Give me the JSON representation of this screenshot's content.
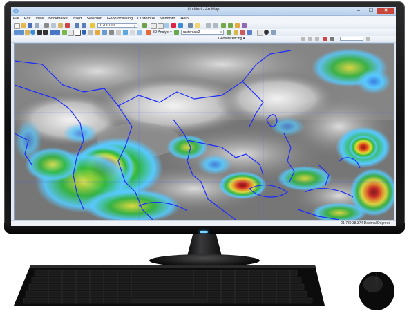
{
  "window": {
    "title": "Untitled - ArcMap",
    "minimize": "–",
    "maximize": "☐",
    "close": "✕"
  },
  "menu": [
    "File",
    "Edit",
    "View",
    "Bookmarks",
    "Insert",
    "Selection",
    "Geoprocessing",
    "Customize",
    "Windows",
    "Help"
  ],
  "toolbar": {
    "scale_value": "1:200.000",
    "analyst_label": "3D Analyst ▾",
    "layer_value": "rastercalc2",
    "georeferencing_label": "Georeferencing ▾"
  },
  "status": {
    "coordinates": "21.789  38.374 Decimal Degrees"
  },
  "icons": {
    "app": "arcmap-globe-icon",
    "zoom_in": "zoom-in-icon",
    "zoom_out": "zoom-out-icon",
    "pan": "pan-hand-icon",
    "full_extent": "globe-icon",
    "identify": "info-icon",
    "select": "select-arrow-icon",
    "add_data": "add-data-icon",
    "save": "save-icon",
    "open": "open-folder-icon",
    "new": "new-doc-icon"
  },
  "colors": {
    "titlebar": "#bcd3ee",
    "close_button": "#c9463d",
    "coastline": "#1b2bff",
    "storm_red": "#d21919",
    "storm_yellow": "#e8e23a",
    "storm_green": "#2fb83c",
    "storm_cyan": "#58c9ff"
  }
}
